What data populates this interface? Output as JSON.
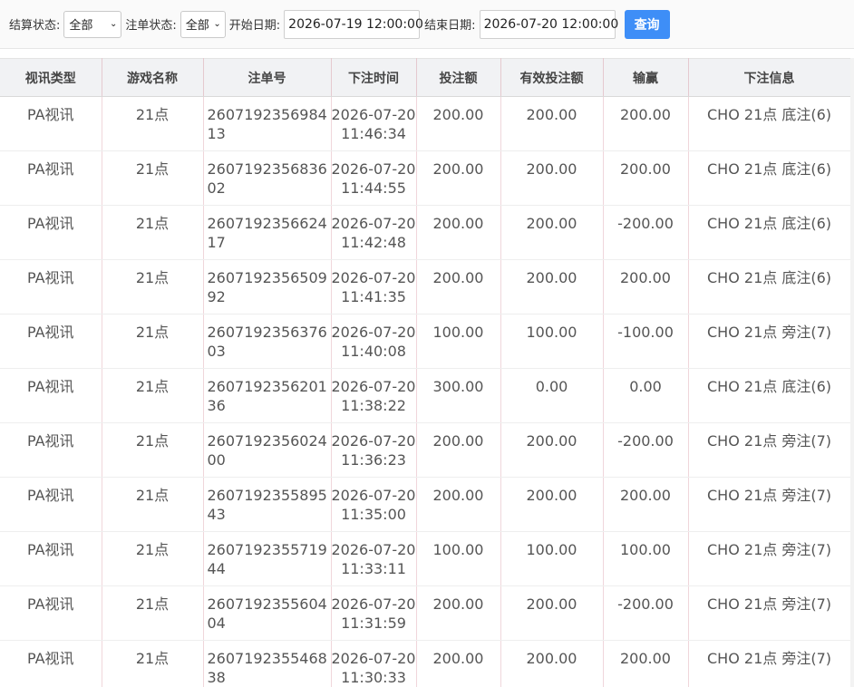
{
  "filters": {
    "settle_label": "结算状态:",
    "settle_value": "全部",
    "order_label": "注单状态:",
    "order_value": "全部",
    "start_label": "开始日期:",
    "start_value": "2026-07-19 12:00:00",
    "end_label": "结束日期:",
    "end_value": "2026-07-20 12:00:00",
    "query_label": "查询"
  },
  "table": {
    "headers": [
      "视讯类型",
      "游戏名称",
      "注单号",
      "下注时间",
      "投注额",
      "有效投注额",
      "输赢",
      "下注信息"
    ],
    "rows": [
      {
        "type": "PA视讯",
        "game": "21点",
        "order": "260719235698413",
        "date": "2026-07-20",
        "time": "11:46:34",
        "bet": "200.00",
        "valid": "200.00",
        "win": "200.00",
        "info": "CHO 21点 底注(6)"
      },
      {
        "type": "PA视讯",
        "game": "21点",
        "order": "260719235683602",
        "date": "2026-07-20",
        "time": "11:44:55",
        "bet": "200.00",
        "valid": "200.00",
        "win": "200.00",
        "info": "CHO 21点 底注(6)"
      },
      {
        "type": "PA视讯",
        "game": "21点",
        "order": "260719235662417",
        "date": "2026-07-20",
        "time": "11:42:48",
        "bet": "200.00",
        "valid": "200.00",
        "win": "-200.00",
        "info": "CHO 21点 底注(6)"
      },
      {
        "type": "PA视讯",
        "game": "21点",
        "order": "260719235650992",
        "date": "2026-07-20",
        "time": "11:41:35",
        "bet": "200.00",
        "valid": "200.00",
        "win": "200.00",
        "info": "CHO 21点 底注(6)"
      },
      {
        "type": "PA视讯",
        "game": "21点",
        "order": "260719235637603",
        "date": "2026-07-20",
        "time": "11:40:08",
        "bet": "100.00",
        "valid": "100.00",
        "win": "-100.00",
        "info": "CHO 21点 旁注(7)"
      },
      {
        "type": "PA视讯",
        "game": "21点",
        "order": "260719235620136",
        "date": "2026-07-20",
        "time": "11:38:22",
        "bet": "300.00",
        "valid": "0.00",
        "win": "0.00",
        "info": "CHO 21点 底注(6)"
      },
      {
        "type": "PA视讯",
        "game": "21点",
        "order": "260719235602400",
        "date": "2026-07-20",
        "time": "11:36:23",
        "bet": "200.00",
        "valid": "200.00",
        "win": "-200.00",
        "info": "CHO 21点 旁注(7)"
      },
      {
        "type": "PA视讯",
        "game": "21点",
        "order": "260719235589543",
        "date": "2026-07-20",
        "time": "11:35:00",
        "bet": "200.00",
        "valid": "200.00",
        "win": "200.00",
        "info": "CHO 21点 旁注(7)"
      },
      {
        "type": "PA视讯",
        "game": "21点",
        "order": "260719235571944",
        "date": "2026-07-20",
        "time": "11:33:11",
        "bet": "100.00",
        "valid": "100.00",
        "win": "100.00",
        "info": "CHO 21点 旁注(7)"
      },
      {
        "type": "PA视讯",
        "game": "21点",
        "order": "260719235560404",
        "date": "2026-07-20",
        "time": "11:31:59",
        "bet": "200.00",
        "valid": "200.00",
        "win": "-200.00",
        "info": "CHO 21点 旁注(7)"
      },
      {
        "type": "PA视讯",
        "game": "21点",
        "order": "260719235546838",
        "date": "2026-07-20",
        "time": "11:30:33",
        "bet": "200.00",
        "valid": "200.00",
        "win": "200.00",
        "info": "CHO 21点 旁注(7)"
      }
    ]
  }
}
